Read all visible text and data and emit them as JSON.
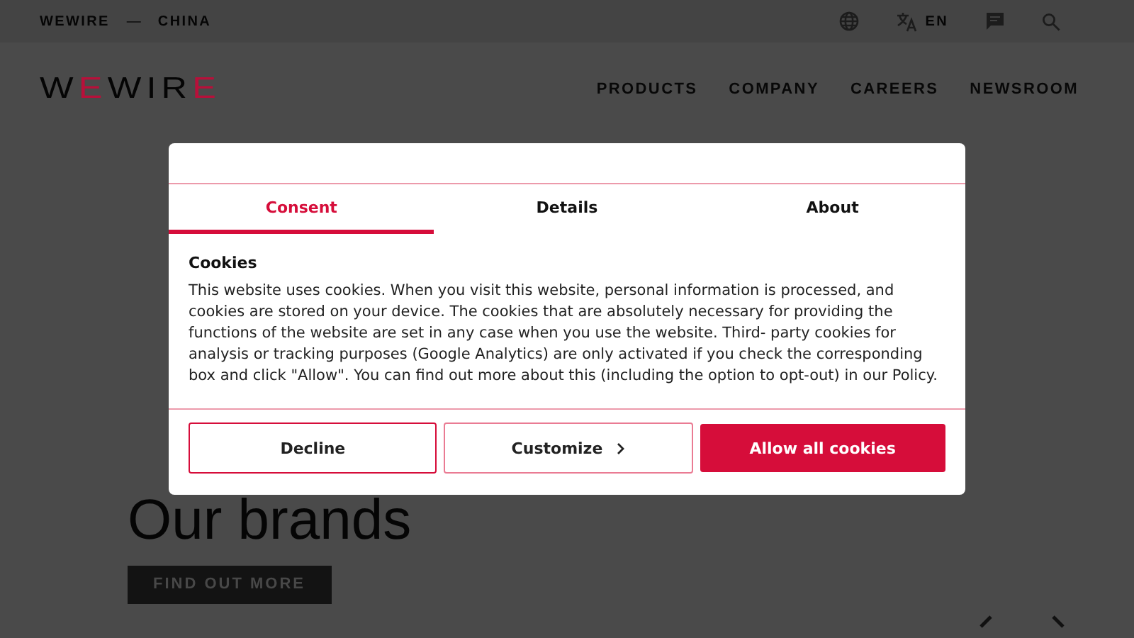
{
  "top_bar": {
    "brand": "WEWIRE",
    "separator": "—",
    "region": "CHINA",
    "language": "EN"
  },
  "header": {
    "logo": [
      {
        "text": "W",
        "accent": false
      },
      {
        "text": "E",
        "accent": true
      },
      {
        "text": "WIR",
        "accent": false
      },
      {
        "text": "E",
        "accent": true
      }
    ],
    "nav": [
      "PRODUCTS",
      "COMPANY",
      "CAREERS",
      "NEWSROOM"
    ]
  },
  "hero": {
    "title": "Our brands",
    "button": "FIND OUT MORE"
  },
  "cookie_dialog": {
    "tabs": [
      {
        "label": "Consent",
        "selected": true
      },
      {
        "label": "Details",
        "selected": false
      },
      {
        "label": "About",
        "selected": false
      }
    ],
    "heading": "Cookies",
    "text": "This website uses cookies. When you visit this website, personal information is processed, and cookies are stored on your device. The cookies that are absolutely necessary for providing the functions of the website are set in any case when you use the website. Third- party cookies for analysis or tracking purposes (Google Analytics) are only activated if you check the corresponding box and click \"Allow\". You can find out more about this (including the option to opt-out) in our Policy.",
    "buttons": [
      {
        "label": "Decline",
        "kind": "outline"
      },
      {
        "label": "Customize",
        "kind": "chevron"
      },
      {
        "label": "Allow all cookies",
        "kind": "primary"
      }
    ]
  }
}
